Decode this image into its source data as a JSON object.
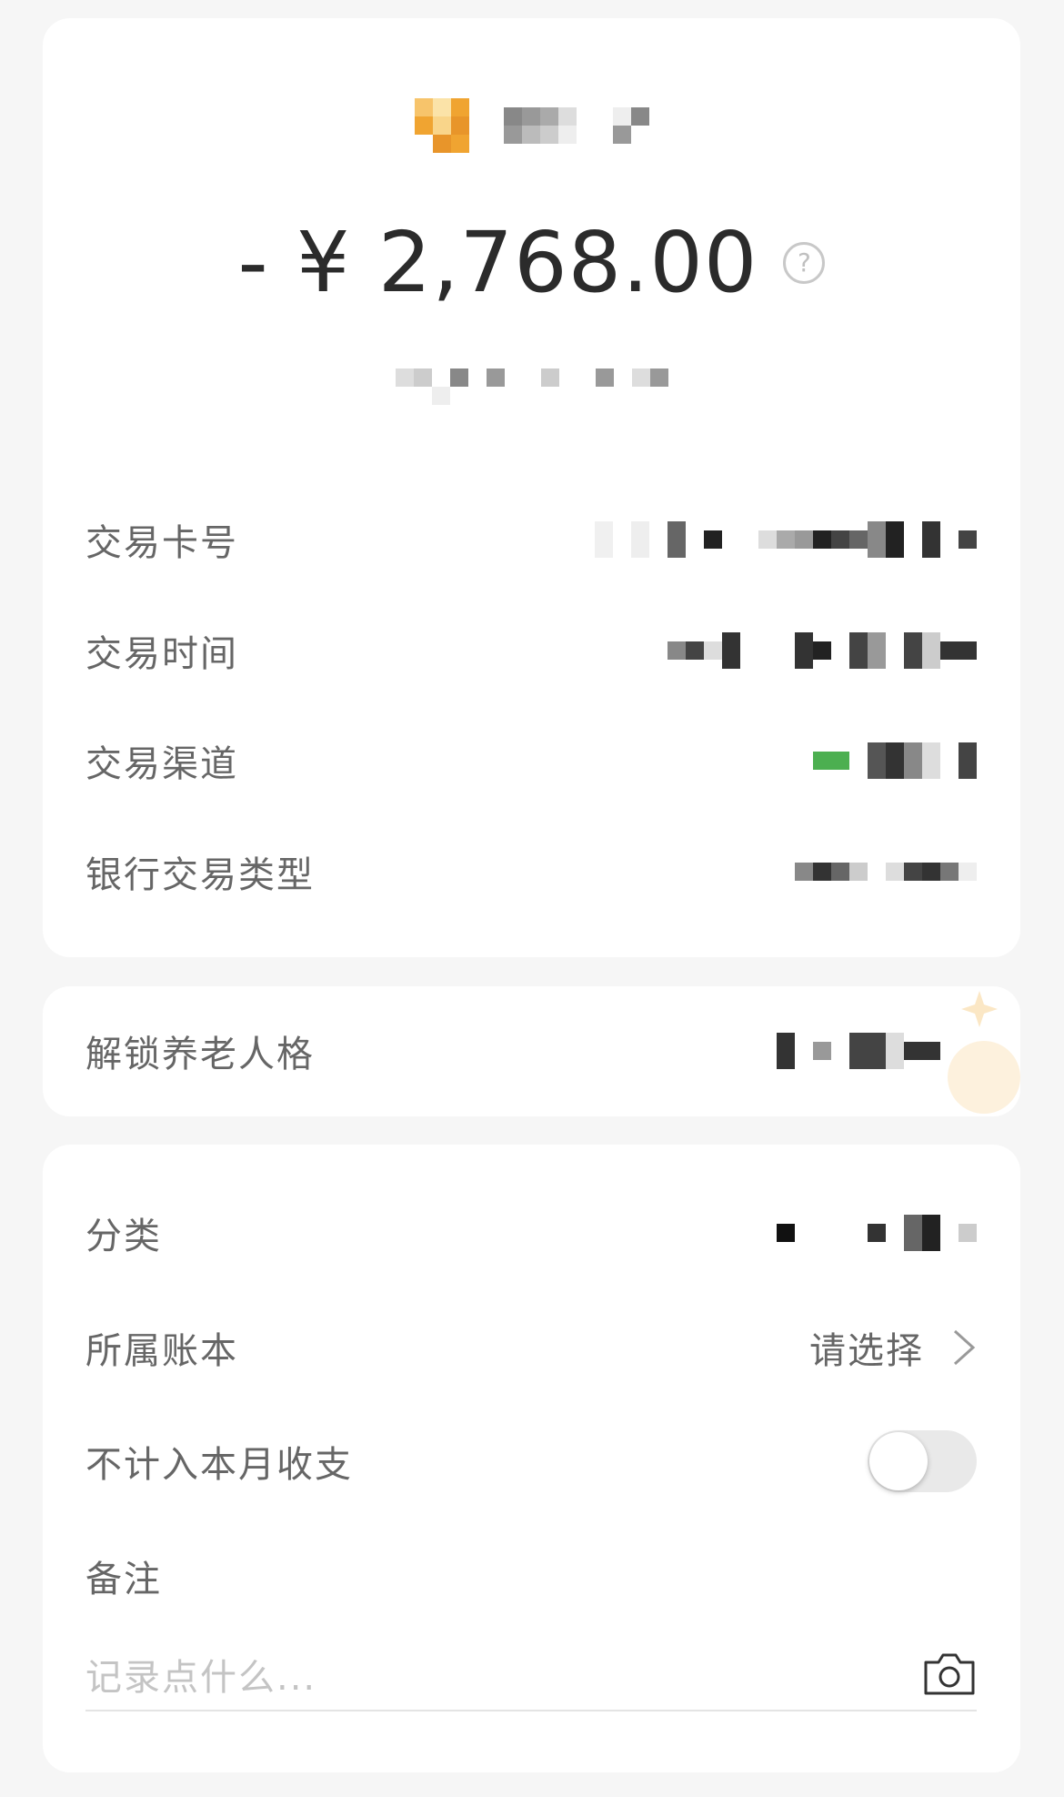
{
  "summary": {
    "amount": "- ¥ 2,768.00",
    "help_symbol": "?"
  },
  "transaction_details": [
    {
      "label": "交易卡号"
    },
    {
      "label": "交易时间"
    },
    {
      "label": "交易渠道"
    },
    {
      "label": "银行交易类型"
    }
  ],
  "promo": {
    "label": "解锁养老人格"
  },
  "settings": {
    "category_label": "分类",
    "ledger_label": "所属账本",
    "ledger_value": "请选择",
    "exclude_label": "不计入本月收支",
    "exclude_enabled": false,
    "note_label": "备注",
    "note_placeholder": "记录点什么..."
  },
  "colors": {
    "background": "#f6f6f6",
    "card": "#ffffff",
    "merchant_logo": "#f0a431",
    "channel_accent": "#4caf50"
  },
  "icons": [
    "help-icon",
    "chevron-right-icon",
    "camera-icon"
  ]
}
